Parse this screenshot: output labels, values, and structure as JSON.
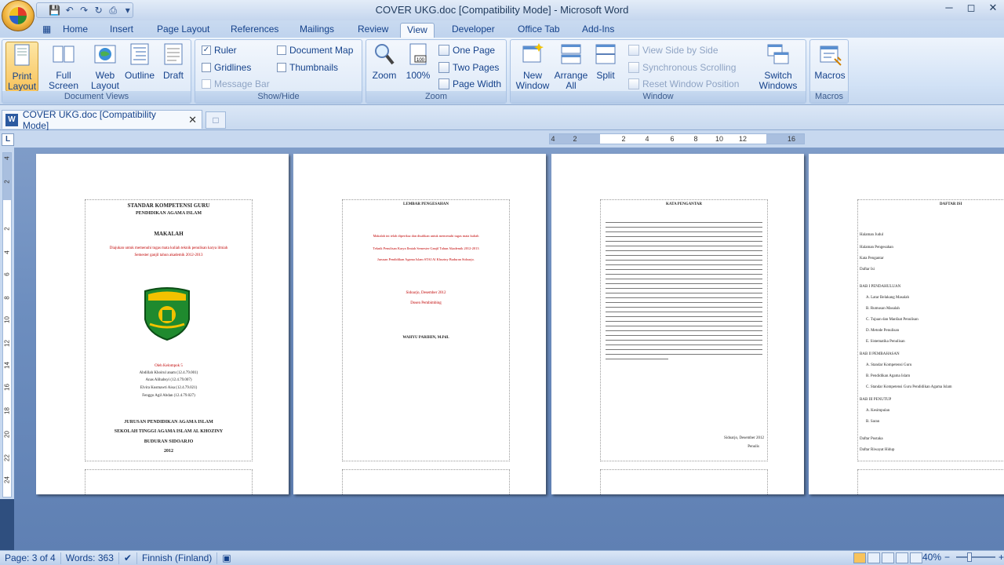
{
  "window": {
    "title": "COVER UKG.doc [Compatibility Mode] - Microsoft Word",
    "controls": [
      "minimize",
      "maximize",
      "close"
    ]
  },
  "qat": {
    "icons": [
      "word-icon",
      "save-icon",
      "undo-icon",
      "redo-icon",
      "repeat-icon",
      "customize-icon"
    ]
  },
  "tabs": [
    {
      "label": "Home"
    },
    {
      "label": "Insert"
    },
    {
      "label": "Page Layout"
    },
    {
      "label": "References"
    },
    {
      "label": "Mailings"
    },
    {
      "label": "Review"
    },
    {
      "label": "View",
      "active": true
    },
    {
      "label": "Developer"
    },
    {
      "label": "Office Tab"
    },
    {
      "label": "Add-Ins"
    }
  ],
  "ribbon": {
    "document_views": {
      "label": "Document Views",
      "print_layout": "Print Layout",
      "full_screen": "Full Screen Reading",
      "web_layout": "Web Layout",
      "outline": "Outline",
      "draft": "Draft"
    },
    "show_hide": {
      "label": "Show/Hide",
      "ruler": "Ruler",
      "ruler_checked": true,
      "gridlines": "Gridlines",
      "message_bar": "Message Bar",
      "document_map": "Document Map",
      "thumbnails": "Thumbnails"
    },
    "zoom": {
      "label": "Zoom",
      "zoom": "Zoom",
      "hundred": "100%",
      "one_page": "One Page",
      "two_pages": "Two Pages",
      "page_width": "Page Width"
    },
    "window": {
      "label": "Window",
      "new_window": "New Window",
      "arrange_all": "Arrange All",
      "split": "Split",
      "view_side": "View Side by Side",
      "sync_scroll": "Synchronous Scrolling",
      "reset_pos": "Reset Window Position",
      "switch_windows": "Switch Windows"
    },
    "macros": {
      "label": "Macros",
      "macros": "Macros"
    }
  },
  "doc_tab": {
    "label": "COVER UKG.doc [Compatibility Mode]"
  },
  "ruler": {
    "h_ticks": [
      "4",
      "2",
      "2",
      "4",
      "6",
      "8",
      "10",
      "12",
      "16"
    ],
    "v_ticks": [
      "4",
      "2",
      "2",
      "4",
      "6",
      "8",
      "10",
      "12",
      "14",
      "16",
      "18",
      "20",
      "22",
      "24"
    ]
  },
  "pages": {
    "cover": {
      "title": "STANDAR KOMPETENSI GURU",
      "subtitle": "PENDIDIKAN AGAMA ISLAM",
      "makalah": "MAKALAH",
      "purpose_1": "Diajukan untuk memenuhi tugas mata kuliah teknik penulisan karya ilmiah",
      "purpose_2": "Semester ganjil tahun akademik 2012-2013",
      "group": "Oleh Kelompok 5",
      "member_1": "Abdillah Khoirul anam (12.4.79.001)",
      "member_2": "Anas Alihabsyi (12.4.79.007)",
      "member_3": "Elvira Kusmawti Aisa (12.4.79.021)",
      "member_4": "Fenggo Agil Abdan (12.4.79.027)",
      "dept": "JURUSAN PENDIDIKAN AGAMA ISLAM",
      "college": "SEKOLAH TINGGI AGAMA ISLAM AL KHOZINY",
      "city": "BUDURAN SIDOARJO",
      "year": "2012"
    },
    "approval": {
      "title": "LEMBAR PENGESAHAN",
      "line_1": "Makalah ini telah diperiksa dan disahkan untuk memenuhi tugas mata kuliah",
      "line_2": "Teknik Penulisan Karya Ilmiah Semester Ganjil Tahun Akademik 2012-2013",
      "line_3": "Jurusan Pendidikan Agama Islam STAI Al Khoziny Buduran Sidoarjo.",
      "date": "Sidoarjo, Desember 2012",
      "role": "Dosen Pembimbing",
      "lecturer": "WAHYU PARIHIN, M.PdI."
    },
    "preface": {
      "title": "KATA PENGANTAR",
      "sign_city": "Sidoarjo, Desember 2012",
      "sign_role": "Penulis"
    },
    "toc": {
      "title": "DAFTAR ISI",
      "rows": [
        "Halaman Judul",
        "Halaman Pengesahan",
        "Kata Pengantar",
        "Daftar Isi",
        "BAB I PENDAHULUAN",
        "A. Latar Belakang Masalah",
        "B. Rumusan Masalah",
        "C. Tujuan dan Manfaat Penulisan",
        "D. Metode Penulisan",
        "E. Sistematika Penulisan",
        "BAB II PEMBAHASAN",
        "A. Standar Kompetensi Guru",
        "B. Pendidikan Agama Islam",
        "C. Standar Kompetensi Guru Pendidikan Agama Islam",
        "BAB III PENUTUP",
        "A. Kesimpulan",
        "B. Saran",
        "Daftar Pustaka",
        "Daftar Riwayat Hidup"
      ]
    }
  },
  "status": {
    "page": "Page: 3 of 4",
    "words": "Words: 363",
    "language": "Finnish (Finland)",
    "zoom": "40%"
  },
  "colors": {
    "accent": "#15428b",
    "ribbon_bg": "#dce8f7",
    "doc_bg": "#6d8ebf",
    "active_button": "#f8c35c"
  }
}
